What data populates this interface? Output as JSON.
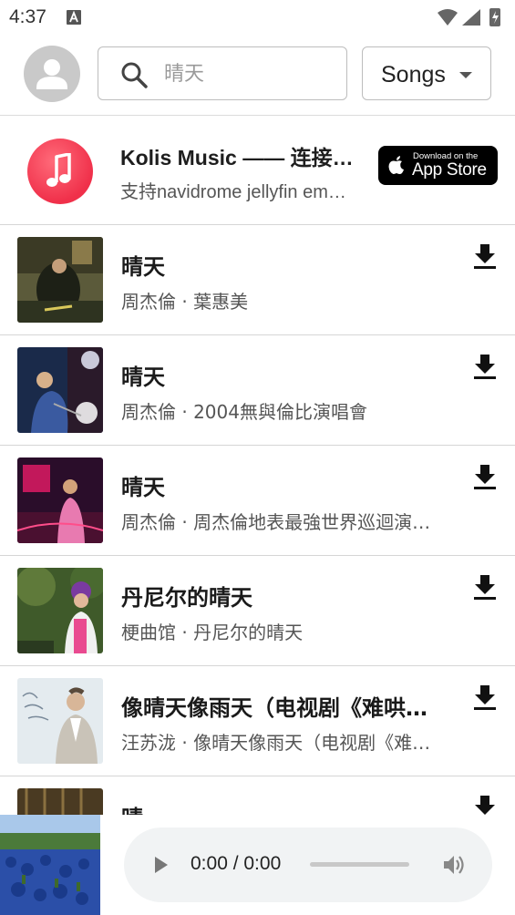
{
  "status_bar": {
    "time": "4:37"
  },
  "header": {
    "search_placeholder": "晴天",
    "type_select": "Songs"
  },
  "banner": {
    "title": "Kolis Music —— 连接Navidrome",
    "subtitle": "支持navidrome jellyfin emby等",
    "app_store_small": "Download on the",
    "app_store_large": "App Store"
  },
  "songs": [
    {
      "title": "晴天",
      "subtitle": "周杰倫 · 葉惠美",
      "cover": "cover-1"
    },
    {
      "title": "晴天",
      "subtitle": "周杰倫 · 2004無與倫比演唱會",
      "cover": "cover-2"
    },
    {
      "title": "晴天",
      "subtitle": "周杰倫 · 周杰倫地表最強世界巡迴演唱會",
      "cover": "cover-3"
    },
    {
      "title": "丹尼尔的晴天",
      "subtitle": "梗曲馆 · 丹尼尔的晴天",
      "cover": "cover-4"
    },
    {
      "title": "像晴天像雨天（电视剧《难哄》插曲）",
      "subtitle": "汪苏泷 · 像晴天像雨天（电视剧《难哄》插曲）",
      "cover": "cover-5"
    },
    {
      "title": "晴",
      "subtitle": "",
      "cover": "cover-6"
    }
  ],
  "player": {
    "time": "0:00 / 0:00"
  },
  "colors": {
    "accent_red": "#f0304a",
    "text_primary": "#1a1a1a",
    "text_secondary": "#555555",
    "divider": "#d5d5d5"
  }
}
